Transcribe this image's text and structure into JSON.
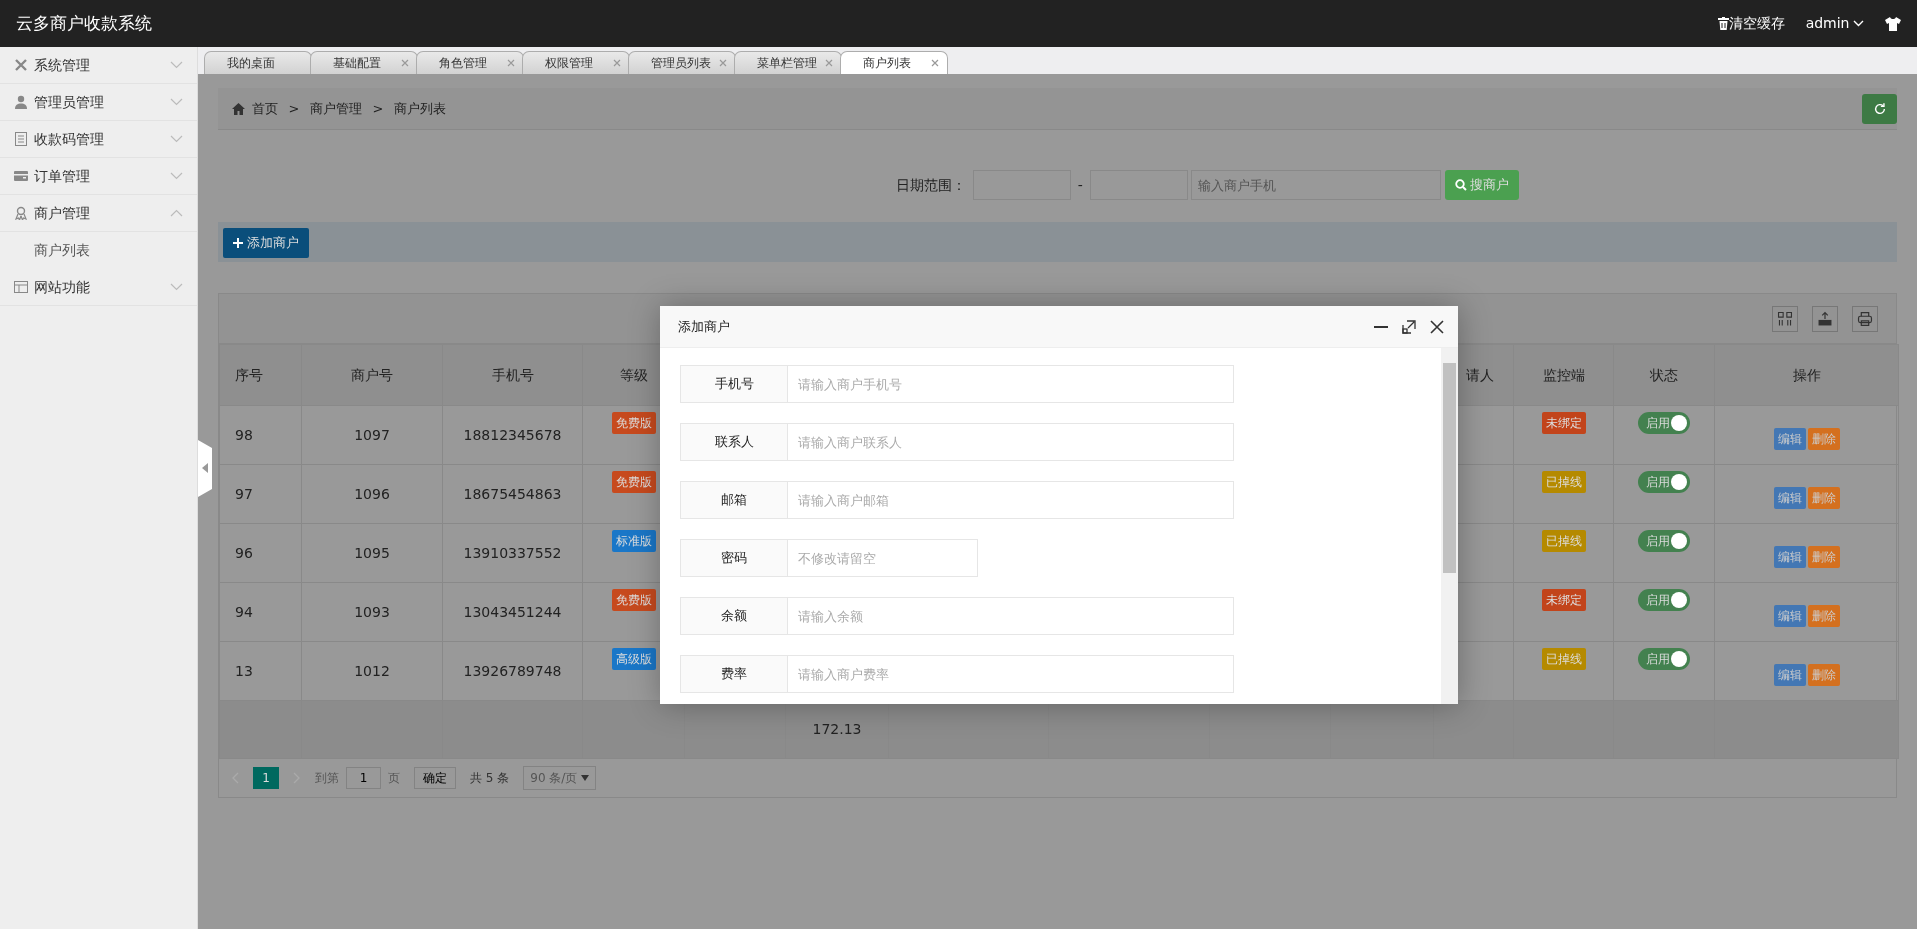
{
  "app": {
    "title": "云多商户收款系统"
  },
  "header": {
    "clear_cache": "清空缓存",
    "user": "admin"
  },
  "sidebar": {
    "items": [
      {
        "label": "系统管理",
        "expanded": false
      },
      {
        "label": "管理员管理",
        "expanded": false
      },
      {
        "label": "收款码管理",
        "expanded": false
      },
      {
        "label": "订单管理",
        "expanded": false
      },
      {
        "label": "商户管理",
        "expanded": true,
        "children": [
          {
            "label": "商户列表"
          }
        ]
      },
      {
        "label": "网站功能",
        "expanded": false
      }
    ]
  },
  "tabs": [
    {
      "label": "我的桌面",
      "closable": false,
      "selected": false
    },
    {
      "label": "基础配置",
      "closable": true,
      "selected": false
    },
    {
      "label": "角色管理",
      "closable": true,
      "selected": false
    },
    {
      "label": "权限管理",
      "closable": true,
      "selected": false
    },
    {
      "label": "管理员列表",
      "closable": true,
      "selected": false
    },
    {
      "label": "菜单栏管理",
      "closable": true,
      "selected": false
    },
    {
      "label": "商户列表",
      "closable": true,
      "selected": true
    }
  ],
  "breadcrumb": {
    "items": [
      "首页",
      "商户管理",
      "商户列表"
    ],
    "separator": ">"
  },
  "search": {
    "label": "日期范围：",
    "range_separator": "-",
    "phone_placeholder": "输入商户手机",
    "button": "搜商户"
  },
  "add_button": "添加商户",
  "table": {
    "columns": [
      {
        "label": "序号"
      },
      {
        "label": "商户号"
      },
      {
        "label": "手机号"
      },
      {
        "label": "等级"
      },
      {
        "label": "请人"
      },
      {
        "label": "监控端"
      },
      {
        "label": "状态"
      },
      {
        "label": "操作"
      }
    ],
    "rows": [
      {
        "index": "98",
        "merchant_no": "1097",
        "phone": "18812345678",
        "level": {
          "label": "免费版",
          "color": "#c74a1e"
        },
        "monitor": {
          "label": "未绑定",
          "color": "#c2441b"
        },
        "enabled": true,
        "status_label": "启用",
        "actions": [
          "编辑",
          "删除"
        ]
      },
      {
        "index": "97",
        "merchant_no": "1096",
        "phone": "18675454863",
        "level": {
          "label": "免费版",
          "color": "#c74a1e"
        },
        "monitor": {
          "label": "已掉线",
          "color": "#b58a00"
        },
        "enabled": true,
        "status_label": "启用",
        "actions": [
          "编辑",
          "删除"
        ]
      },
      {
        "index": "96",
        "merchant_no": "1095",
        "phone": "13910337552",
        "level": {
          "label": "标准版",
          "color": "#1a77c8"
        },
        "monitor": {
          "label": "已掉线",
          "color": "#b58a00"
        },
        "enabled": true,
        "status_label": "启用",
        "actions": [
          "编辑",
          "删除"
        ]
      },
      {
        "index": "94",
        "merchant_no": "1093",
        "phone": "13043451244",
        "level": {
          "label": "免费版",
          "color": "#c74a1e"
        },
        "monitor": {
          "label": "未绑定",
          "color": "#c2441b"
        },
        "enabled": true,
        "status_label": "启用",
        "actions": [
          "编辑",
          "删除"
        ]
      },
      {
        "index": "13",
        "merchant_no": "1012",
        "phone": "13926789748",
        "level": {
          "label": "高级版",
          "color": "#1a77c8"
        },
        "monitor": {
          "label": "已掉线",
          "color": "#b58a00"
        },
        "enabled": true,
        "status_label": "启用",
        "actions": [
          "编辑",
          "删除"
        ]
      }
    ],
    "total_amount": "172.13"
  },
  "pagination": {
    "pages": [
      {
        "label": "1",
        "selected": true
      }
    ],
    "goto_label": "到第",
    "goto_value": "1",
    "page_unit": "页",
    "confirm": "确定",
    "total": "共 5 条",
    "page_size": "90 条/页"
  },
  "dialog": {
    "title": "添加商户",
    "fields": [
      {
        "label": "手机号",
        "placeholder": "请输入商户手机号",
        "wide": true
      },
      {
        "label": "联系人",
        "placeholder": "请输入商户联系人",
        "wide": true
      },
      {
        "label": "邮箱",
        "placeholder": "请输入商户邮箱",
        "wide": true
      },
      {
        "label": "密码",
        "placeholder": "不修改请留空",
        "wide": false
      },
      {
        "label": "余额",
        "placeholder": "请输入余额",
        "wide": true
      },
      {
        "label": "费率",
        "placeholder": "请输入商户费率",
        "wide": true
      }
    ]
  }
}
